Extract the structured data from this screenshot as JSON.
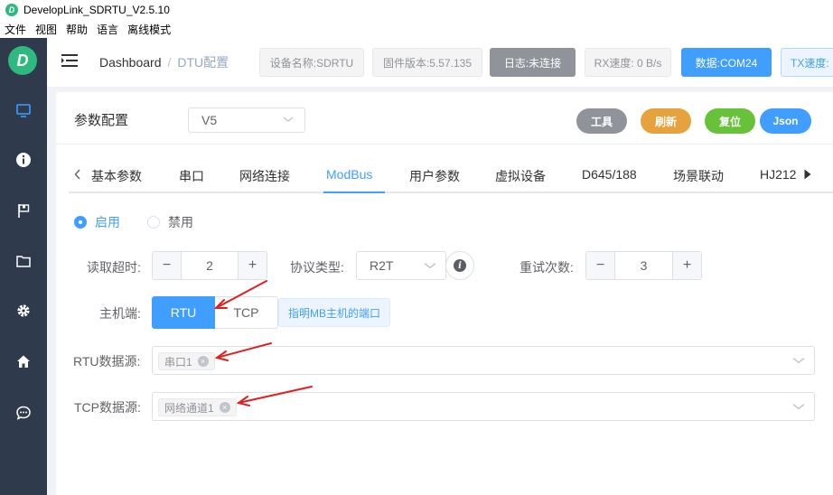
{
  "window": {
    "title": "DevelopLink_SDRTU_V2.5.10",
    "logo_letter": "D"
  },
  "menubar": {
    "items": [
      "文件",
      "视图",
      "帮助",
      "语言",
      "离线模式"
    ]
  },
  "sidebar": {
    "logo_letter": "D",
    "icons": [
      "monitor-icon",
      "info-icon",
      "flag-icon",
      "folder-icon",
      "gear-icon",
      "home-icon",
      "chat-icon"
    ]
  },
  "header": {
    "breadcrumb": {
      "root": "Dashboard",
      "separator": "/",
      "current": "DTU配置"
    },
    "device_name": "设备名称:SDRTU",
    "firmware": "固件版本:5.57.135",
    "log_status": "日志:未连接",
    "rx_speed": "RX速度: 0 B/s",
    "data_port": "数据:COM24",
    "tx_speed": "TX速度:"
  },
  "config": {
    "title": "参数配置",
    "version": "V5",
    "buttons": {
      "tools": "工具",
      "refresh": "刷新",
      "reset": "复位",
      "json": "Json"
    },
    "tabs": [
      "基本参数",
      "串口",
      "网络连接",
      "ModBus",
      "用户参数",
      "虚拟设备",
      "D645/188",
      "场景联动",
      "HJ212"
    ],
    "active_tab": "ModBus"
  },
  "modbus": {
    "enable_label": "启用",
    "disable_label": "禁用",
    "enabled": true,
    "read_timeout_label": "读取超时:",
    "read_timeout": "2",
    "protocol_label": "协议类型:",
    "protocol": "R2T",
    "retries_label": "重试次数:",
    "retries": "3",
    "host_label": "主机端:",
    "host_options": [
      "RTU",
      "TCP"
    ],
    "host_selected": "RTU",
    "host_hint": "指明MB主机的端口",
    "rtu_source_label": "RTU数据源:",
    "rtu_source": "串口1",
    "tcp_source_label": "TCP数据源:",
    "tcp_source": "网络通道1"
  },
  "colors": {
    "sidebar_bg": "#2f3a4c",
    "brand_green": "#2fb880",
    "primary": "#409eff",
    "tools_gray": "#909399",
    "refresh_orange": "#e6a23c",
    "reset_green": "#67c23a",
    "annotation_red": "#e02020"
  }
}
